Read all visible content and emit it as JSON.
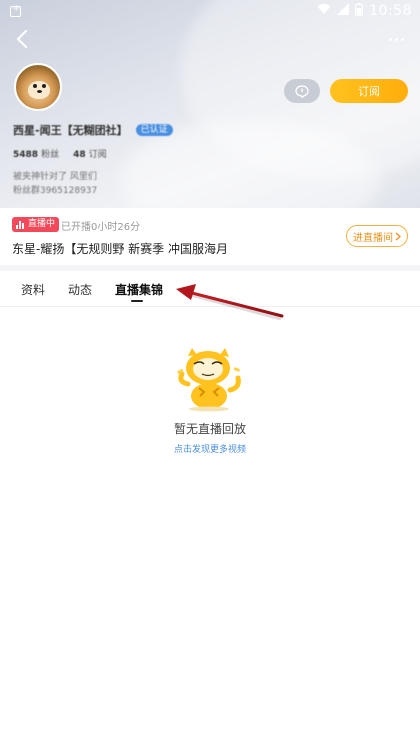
{
  "status_bar": {
    "time": "10:58"
  },
  "profile": {
    "name": "西星-闻王【无糊团社】",
    "verified_label": "已认证",
    "stats": [
      {
        "value": "5488",
        "label": "粉丝"
      },
      {
        "value": "48",
        "label": "订阅"
      }
    ],
    "bio_line1": "被夹神针对了 风里们",
    "bio_line2": "粉丝群3965128937"
  },
  "actions": {
    "subscribe_label": "订阅"
  },
  "live": {
    "badge_label": "直播中",
    "duration": "已开播0小时26分",
    "title": "东星-耀扬【无规则野 新赛季 冲国服海月",
    "enter_label": "进直播间"
  },
  "tabs": [
    {
      "label": "资料"
    },
    {
      "label": "动态"
    },
    {
      "label": "直播集锦"
    }
  ],
  "empty_state": {
    "message": "暂无直播回放",
    "link": "点击发现更多视频"
  },
  "colors": {
    "accent": "#ffb515",
    "live_red": "#f24a5b",
    "link_blue": "#4a8fe0",
    "annotation_arrow": "#b3161c"
  }
}
